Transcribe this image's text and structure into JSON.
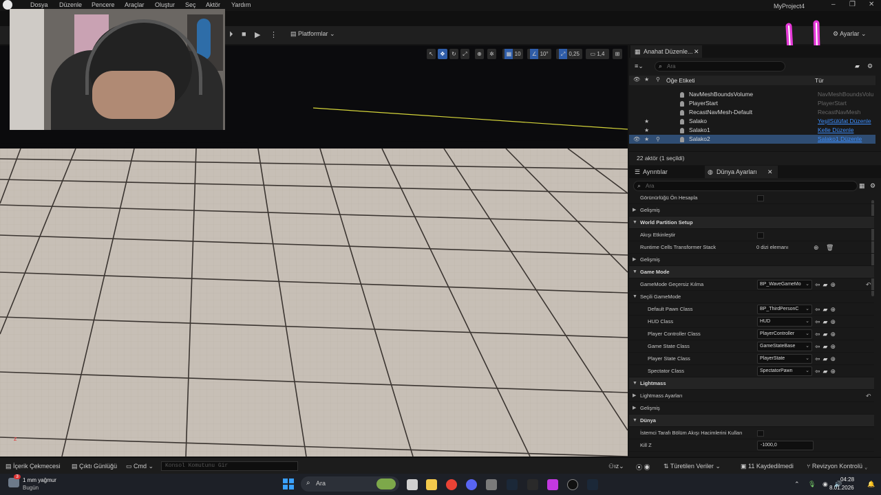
{
  "menubar": {
    "items": [
      "Dosya",
      "Düzenle",
      "Pencere",
      "Araçlar",
      "Oluştur",
      "Seç",
      "Aktör",
      "Yardım"
    ],
    "project_title": "MyProject4"
  },
  "toolbar": {
    "platforms_label": "Platformlar",
    "settings_label": "Ayarlar"
  },
  "viewport_toolbar": {
    "grid_snap": "10",
    "rotation_snap": "10°",
    "scale_snap": "0,25",
    "camera_speed": "1,4"
  },
  "outliner": {
    "tab_label": "Anahat Düzenle...",
    "search_placeholder": "Ara",
    "col_label": "Öğe Etiketi",
    "col_type": "Tür",
    "rows": [
      {
        "name": "NavMeshBoundsVolume",
        "type": "NavMeshBoundsVolu",
        "star": false,
        "link": false
      },
      {
        "name": "PlayerStart",
        "type": "PlayerStart",
        "star": false,
        "link": false
      },
      {
        "name": "RecastNavMesh-Default",
        "type": "RecastNavMesh",
        "star": false,
        "link": false
      },
      {
        "name": "Salako",
        "type": "YeşilSülüfat Düzenle",
        "star": true,
        "link": true
      },
      {
        "name": "Salako1",
        "type": "Kelle Düzenle",
        "star": true,
        "link": true
      },
      {
        "name": "Salako2",
        "type": "Salako1 Düzenle",
        "star": true,
        "link": true,
        "selected": true
      }
    ],
    "status": "22 aktör (1 seçildi)"
  },
  "details": {
    "tab_details": "Ayrıntılar",
    "tab_world": "Dünya Ayarları",
    "search_placeholder": "Ara",
    "rows": [
      {
        "kind": "check",
        "label": "Görünürlüğü Ön Hesapla"
      },
      {
        "kind": "sub",
        "label": "Gelişmiş"
      },
      {
        "kind": "cat",
        "label": "World Partition Setup"
      },
      {
        "kind": "check",
        "label": "Akışı Etkinleştir"
      },
      {
        "kind": "array",
        "label": "Runtime Cells Transformer Stack",
        "value": "0 dizi elemanı"
      },
      {
        "kind": "sub",
        "label": "Gelişmiş"
      },
      {
        "kind": "cat",
        "label": "Game Mode"
      },
      {
        "kind": "dd",
        "label": "GameMode Geçersiz Kılma",
        "value": "BP_WaveGameMo",
        "reset": true
      },
      {
        "kind": "subopen",
        "label": "Seçili GameMode"
      },
      {
        "kind": "dd2",
        "label": "Default Pawn Class",
        "value": "BP_ThirdPersonC"
      },
      {
        "kind": "dd2",
        "label": "HUD Class",
        "value": "HUD"
      },
      {
        "kind": "dd2",
        "label": "Player Controller Class",
        "value": "PlayerController"
      },
      {
        "kind": "dd2",
        "label": "Game State Class",
        "value": "GameStateBase"
      },
      {
        "kind": "dd2",
        "label": "Player State Class",
        "value": "PlayerState"
      },
      {
        "kind": "dd2",
        "label": "Spectator Class",
        "value": "SpectatorPawn"
      },
      {
        "kind": "cat",
        "label": "Lightmass"
      },
      {
        "kind": "sub",
        "label": "Lightmass Ayarları",
        "reset": true
      },
      {
        "kind": "sub",
        "label": "Gelişmiş"
      },
      {
        "kind": "cat",
        "label": "Dünya"
      },
      {
        "kind": "check",
        "label": "İstemci Tarafı Bölüm Akışı Hacimlerini Kullan"
      },
      {
        "kind": "num",
        "label": "Kill Z",
        "value": "-1000,0"
      }
    ]
  },
  "statusbar": {
    "content_drawer": "İçerik Çekmecesi",
    "output_log": "Çıktı Günlüğü",
    "cmd": "Cmd",
    "console_placeholder": "Konsol Komutunu Gir",
    "derived_data": "Türetilen Veriler",
    "unsaved": "11 Kaydedilmedi",
    "revision": "Revizyon Kontrolü"
  },
  "taskbar": {
    "weather_temp": "1 mm yağmur",
    "weather_day": "Bugün",
    "badge": "3",
    "search": "Ara",
    "time": "04:28",
    "date": "8.01.2026"
  },
  "colors": {
    "accent": "#2f5da8",
    "link": "#3d8fff",
    "smiley": "#e53ad8"
  }
}
